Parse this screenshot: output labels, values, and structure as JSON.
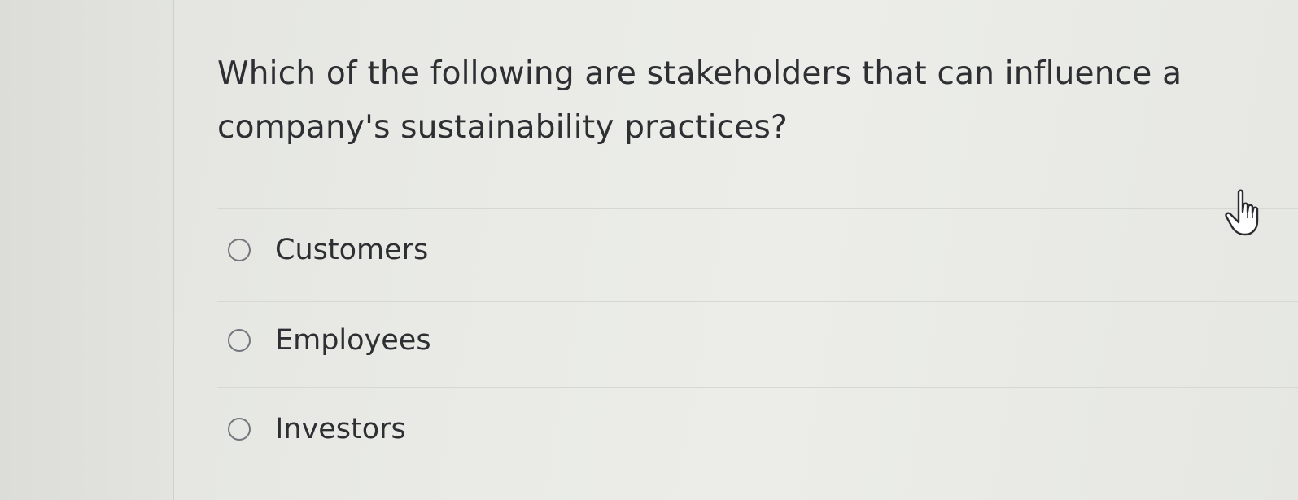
{
  "question": {
    "text": "Which of the following are stakeholders that can influence a company's sustainability practices?"
  },
  "options": [
    {
      "label": "Customers",
      "selected": false
    },
    {
      "label": "Employees",
      "selected": false
    },
    {
      "label": "Investors",
      "selected": false
    }
  ],
  "icons": {
    "pointer": "hand-pointer-icon",
    "radio": "radio-unchecked-icon"
  },
  "colors": {
    "text": "#2e2f33",
    "radio_border": "#73767c",
    "background": "#e9eae6"
  }
}
